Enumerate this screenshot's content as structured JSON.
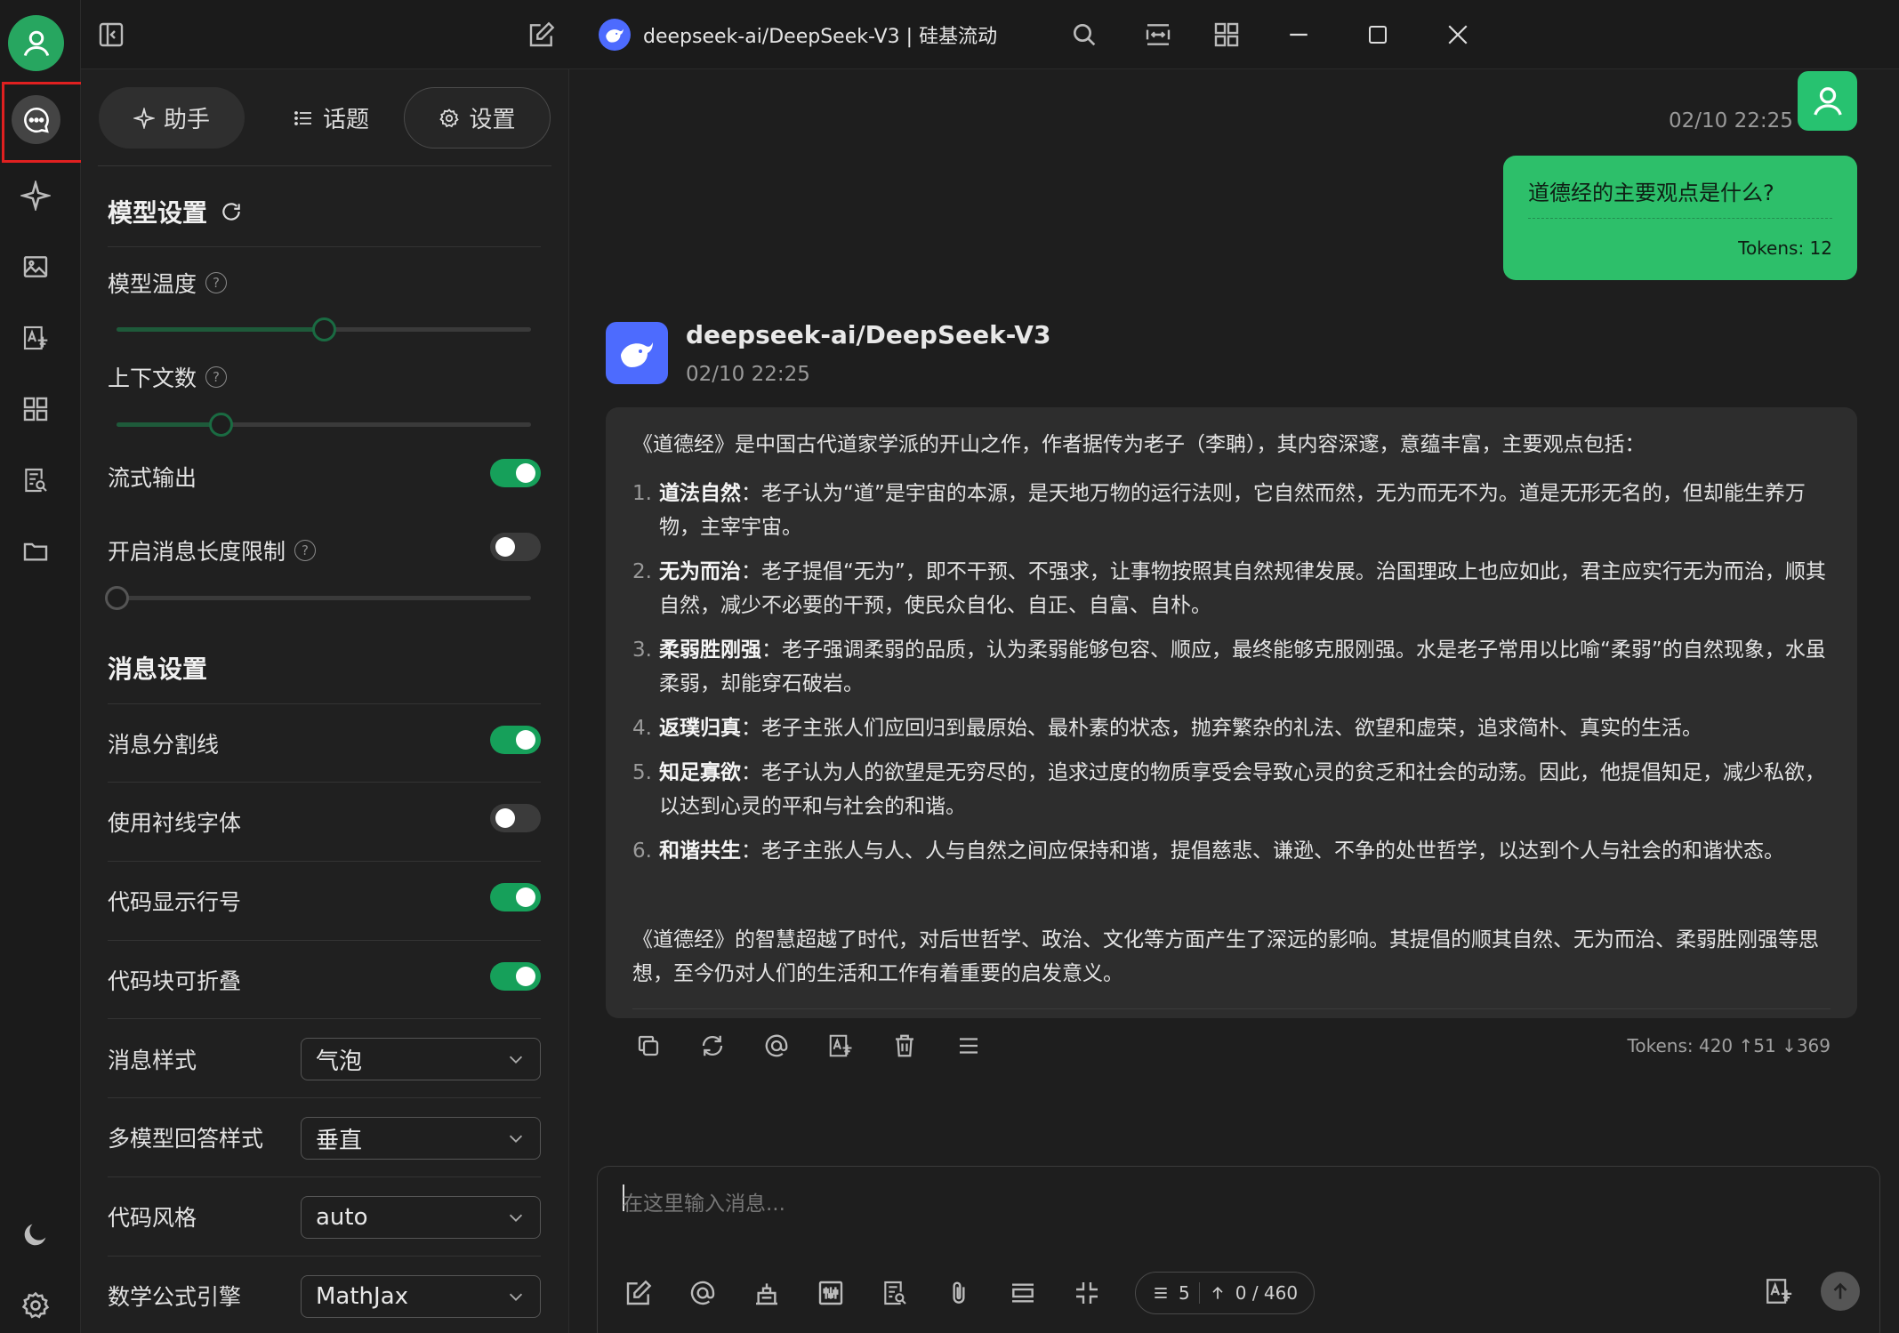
{
  "colors": {
    "accent": "#16a05a",
    "user_bubble": "#2dbf6a",
    "bot_brand": "#4d6bfe",
    "highlight": "#e02020"
  },
  "titlebar": {
    "title": "deepseek-ai/DeepSeek-V3 | 硅基流动",
    "icons": [
      "sidebar-toggle-icon",
      "edit-icon",
      "search-icon",
      "expand-width-icon",
      "grid-icon",
      "minimize-icon",
      "maximize-icon",
      "close-icon"
    ]
  },
  "rail": {
    "items": [
      "chat-icon",
      "sparkle-icon",
      "image-icon",
      "translate-icon",
      "apps-icon",
      "knowledge-icon",
      "folder-icon"
    ],
    "bottom": [
      "moon-icon",
      "gear-icon"
    ]
  },
  "settings": {
    "tabs": [
      {
        "label": "助手",
        "icon": "sparkle-icon"
      },
      {
        "label": "话题",
        "icon": "list-icon"
      },
      {
        "label": "设置",
        "icon": "gear-icon"
      }
    ],
    "model_section": {
      "title": "模型设置",
      "temperature_label": "模型温度",
      "temperature_level": 0.5,
      "context_label": "上下文数",
      "context_level": 0.25,
      "stream_label": "流式输出",
      "stream_on": true,
      "length_limit_label": "开启消息长度限制",
      "length_limit_on": false,
      "length_level": 0
    },
    "message_section": {
      "title": "消息设置",
      "toggles": [
        {
          "label": "消息分割线",
          "on": true
        },
        {
          "label": "使用衬线字体",
          "on": false
        },
        {
          "label": "代码显示行号",
          "on": true
        },
        {
          "label": "代码块可折叠",
          "on": true
        }
      ],
      "selects": [
        {
          "label": "消息样式",
          "value": "气泡"
        },
        {
          "label": "多模型回答样式",
          "value": "垂直"
        },
        {
          "label": "代码风格",
          "value": "auto"
        },
        {
          "label": "数学公式引擎",
          "value": "MathJax"
        }
      ]
    }
  },
  "chat": {
    "user": {
      "time": "02/10 22:25",
      "message": "道德经的主要观点是什么?",
      "tokens": "Tokens: 12"
    },
    "bot": {
      "name": "deepseek-ai/DeepSeek-V3",
      "time": "02/10 22:25",
      "intro": "《道德经》是中国古代道家学派的开山之作，作者据传为老子（李聃），其内容深邃，意蕴丰富，主要观点包括：",
      "points": [
        {
          "num": "1.",
          "title": "道法自然",
          "text": "：老子认为“道”是宇宙的本源，是天地万物的运行法则，它自然而然，无为而无不为。道是无形无名的，但却能生养万物，主宰宇宙。"
        },
        {
          "num": "2.",
          "title": "无为而治",
          "text": "：老子提倡“无为”，即不干预、不强求，让事物按照其自然规律发展。治国理政上也应如此，君主应实行无为而治，顺其自然，减少不必要的干预，使民众自化、自正、自富、自朴。"
        },
        {
          "num": "3.",
          "title": "柔弱胜刚强",
          "text": "：老子强调柔弱的品质，认为柔弱能够包容、顺应，最终能够克服刚强。水是老子常用以比喻“柔弱”的自然现象，水虽柔弱，却能穿石破岩。"
        },
        {
          "num": "4.",
          "title": "返璞归真",
          "text": "：老子主张人们应回归到最原始、最朴素的状态，抛弃繁杂的礼法、欲望和虚荣，追求简朴、真实的生活。"
        },
        {
          "num": "5.",
          "title": "知足寡欲",
          "text": "：老子认为人的欲望是无穷尽的，追求过度的物质享受会导致心灵的贫乏和社会的动荡。因此，他提倡知足，减少私欲，以达到心灵的平和与社会的和谐。"
        },
        {
          "num": "6.",
          "title": "和谐共生",
          "text": "：老子主张人与人、人与自然之间应保持和谐，提倡慈悲、谦逊、不争的处世哲学，以达到个人与社会的和谐状态。"
        }
      ],
      "outro": "《道德经》的智慧超越了时代，对后世哲学、政治、文化等方面产生了深远的影响。其提倡的顺其自然、无为而治、柔弱胜刚强等思想，至今仍对人们的生活和工作有着重要的启发意义。",
      "tokens": "Tokens: 420 ↑51 ↓369",
      "actions": [
        "copy-icon",
        "regenerate-icon",
        "mention-icon",
        "translate-icon",
        "delete-icon",
        "menu-icon"
      ]
    },
    "input": {
      "placeholder": "在这里输入消息...",
      "context_count": "5",
      "token_count": "0 / 460",
      "tools": [
        "new-topic-icon",
        "mention-icon",
        "knowledge-icon",
        "settings-sliders-icon",
        "web-search-icon",
        "attachment-icon",
        "clear-icon",
        "fullscreen-icon"
      ]
    }
  }
}
